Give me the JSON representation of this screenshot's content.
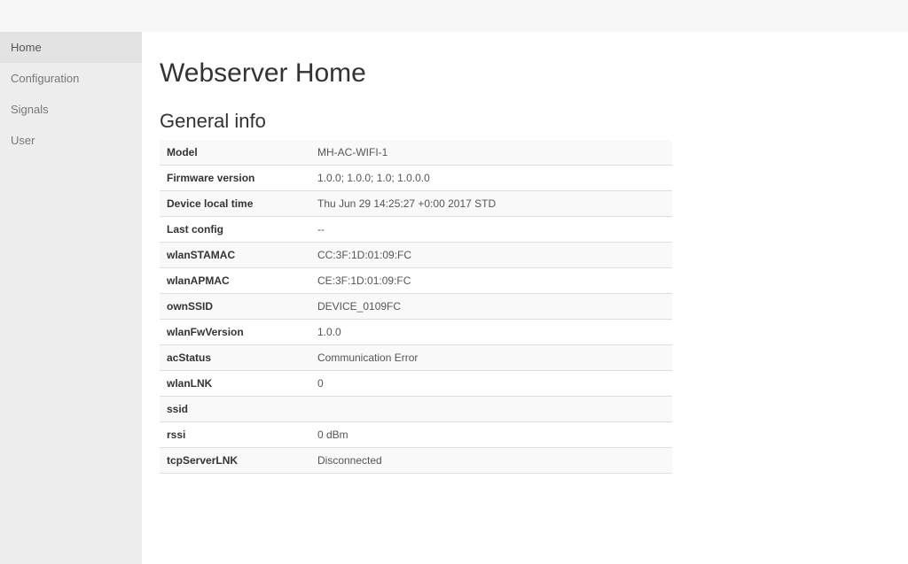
{
  "sidebar": {
    "items": [
      {
        "label": "Home",
        "active": true
      },
      {
        "label": "Configuration",
        "active": false
      },
      {
        "label": "Signals",
        "active": false
      },
      {
        "label": "User",
        "active": false
      }
    ]
  },
  "page": {
    "title": "Webserver Home"
  },
  "general_info": {
    "heading": "General info",
    "rows": [
      {
        "label": "Model",
        "value": "MH-AC-WIFI-1"
      },
      {
        "label": "Firmware version",
        "value": "1.0.0; 1.0.0; 1.0; 1.0.0.0"
      },
      {
        "label": "Device local time",
        "value": "Thu Jun 29 14:25:27 +0:00 2017 STD"
      },
      {
        "label": "Last config",
        "value": "--"
      },
      {
        "label": "wlanSTAMAC",
        "value": "CC:3F:1D:01:09:FC"
      },
      {
        "label": "wlanAPMAC",
        "value": "CE:3F:1D:01:09:FC"
      },
      {
        "label": "ownSSID",
        "value": "DEVICE_0109FC"
      },
      {
        "label": "wlanFwVersion",
        "value": "1.0.0"
      },
      {
        "label": "acStatus",
        "value": "Communication Error"
      },
      {
        "label": "wlanLNK",
        "value": "0"
      },
      {
        "label": "ssid",
        "value": ""
      },
      {
        "label": "rssi",
        "value": "0 dBm"
      },
      {
        "label": "tcpServerLNK",
        "value": "Disconnected"
      }
    ]
  }
}
